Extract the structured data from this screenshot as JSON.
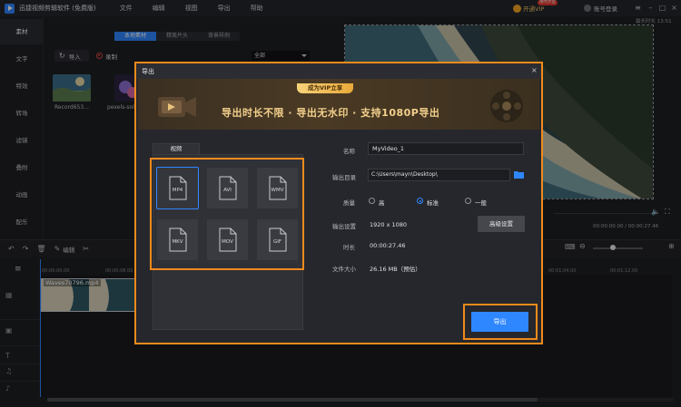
{
  "app": {
    "title": "迅捷视频剪辑软件 (免费版)",
    "menus": [
      "文件",
      "编辑",
      "视图",
      "导出",
      "帮助"
    ],
    "vip_label": "开通VIP",
    "vip_badge": "限时大促",
    "login_label": "账号登录"
  },
  "sidebar": {
    "items": [
      "素材",
      "文字",
      "特效",
      "转场",
      "滤镜",
      "叠附",
      "动画",
      "配乐"
    ],
    "active_index": 0
  },
  "media": {
    "tabs": [
      "本地素材",
      "精美片头",
      "背景样例"
    ],
    "active_tab": 0,
    "import_label": "导入",
    "record_label": "录制",
    "filter_value": "全部",
    "items": [
      {
        "label": "Record653..."
      },
      {
        "label": "pexels-solo..."
      }
    ]
  },
  "preview": {
    "duration_label": "最长时长 13:51",
    "timecode": "00:00:00.00 / 00:00:27.46"
  },
  "timeline": {
    "edit_label": "编辑",
    "ruler": [
      "00:00:00.00",
      "00:00:08.00",
      "00:01:04.00",
      "00:01:12.00"
    ],
    "clip_name": "Waves70796.mp4"
  },
  "export_dialog": {
    "title": "导出",
    "banner_pill": "成为VIP立享",
    "banner_text": "导出时长不限 · 导出无水印 · 支持1080P导出",
    "format_tab": "视频",
    "formats": [
      "MP4",
      "AVI",
      "WMV",
      "MKV",
      "MOV",
      "GIF"
    ],
    "selected_format": "MP4",
    "fields": {
      "name_label": "名称",
      "name_value": "MyVideo_1",
      "dir_label": "输出目录",
      "dir_value": "C:\\Users\\mayn\\Desktop\\",
      "quality_label": "质量",
      "quality_options": [
        "高",
        "标准",
        "一般"
      ],
      "quality_selected": "标准",
      "settings_label": "输出设置",
      "settings_value": "1920 x 1080",
      "advanced_label": "高级设置",
      "duration_label": "时长",
      "duration_value": "00:00:27.46",
      "size_label": "文件大小",
      "size_value": "26.16 MB（预估）"
    },
    "export_label": "导出"
  },
  "colors": {
    "accent": "#2f87ff",
    "highlight": "#f08a1c",
    "vip_gold": "#f3d08c"
  }
}
